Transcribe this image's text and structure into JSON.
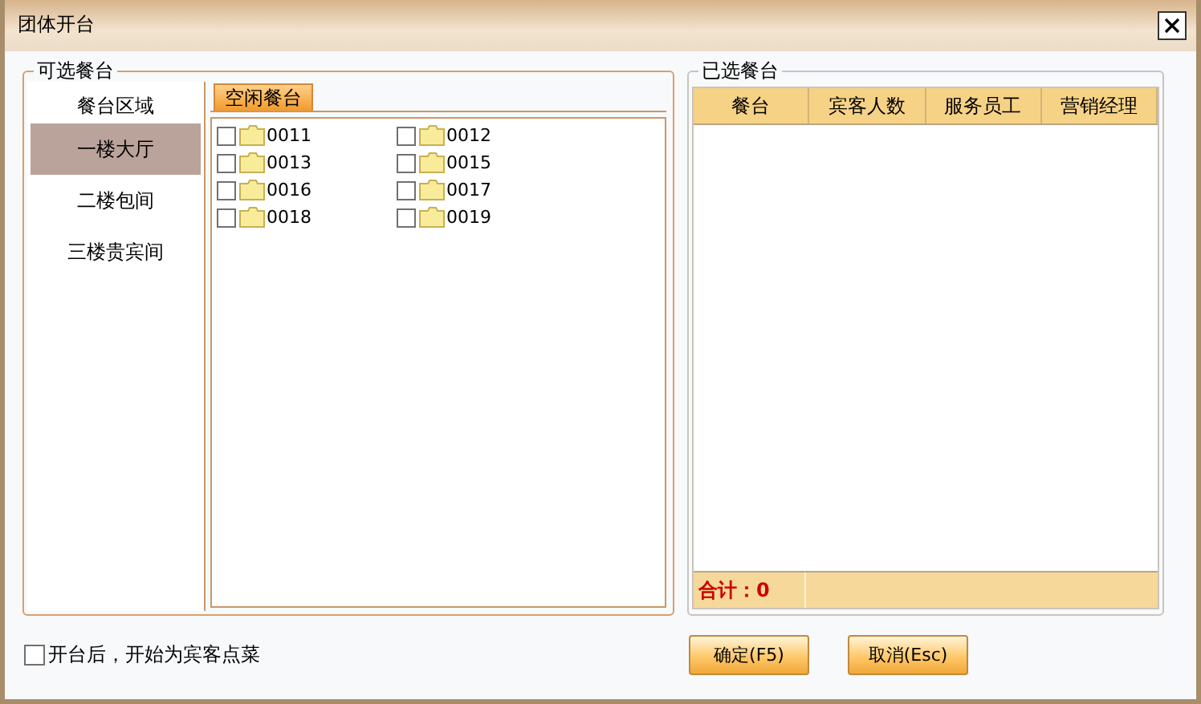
{
  "window": {
    "title": "团体开台"
  },
  "available": {
    "title": "可选餐台",
    "area_header": "餐台区域",
    "areas": [
      {
        "label": "一楼大厅",
        "selected": true
      },
      {
        "label": "二楼包间",
        "selected": false
      },
      {
        "label": "三楼贵宾间",
        "selected": false
      }
    ],
    "tab": "空闲餐台",
    "tables": [
      {
        "label": "0011",
        "checked": false
      },
      {
        "label": "0012",
        "checked": false
      },
      {
        "label": "0013",
        "checked": false
      },
      {
        "label": "0015",
        "checked": false
      },
      {
        "label": "0016",
        "checked": false
      },
      {
        "label": "0017",
        "checked": false
      },
      {
        "label": "0018",
        "checked": false
      },
      {
        "label": "0019",
        "checked": false
      }
    ]
  },
  "selected": {
    "title": "已选餐台",
    "columns": [
      "餐台",
      "宾客人数",
      "服务员工",
      "营销经理"
    ],
    "total": "合计：0"
  },
  "option": {
    "label": "开台后，开始为宾客点菜",
    "checked": false
  },
  "buttons": [
    "确定(F5)",
    "取消(Esc)"
  ]
}
